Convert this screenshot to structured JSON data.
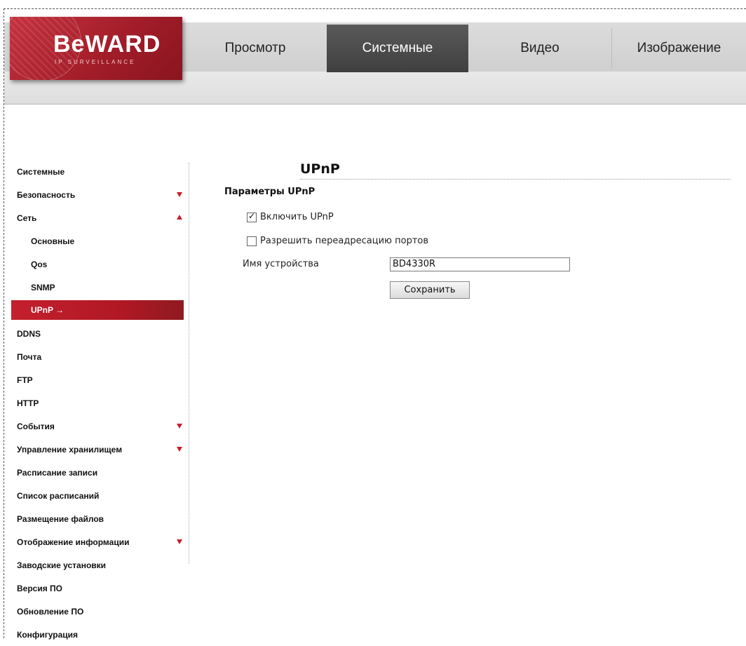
{
  "brand": {
    "name": "BeWARD",
    "tagline": "IP SURVEILLANCE",
    "color": "#b01c28"
  },
  "tabs": [
    {
      "label": "Просмотр",
      "active": false
    },
    {
      "label": "Системные",
      "active": true
    },
    {
      "label": "Видео",
      "active": false
    },
    {
      "label": "Изображение",
      "active": false
    }
  ],
  "sidebar": {
    "items": [
      {
        "label": "Системные",
        "arrow": ""
      },
      {
        "label": "Безопасность",
        "arrow": "down"
      },
      {
        "label": "Сеть",
        "arrow": "up"
      },
      {
        "label": "Основные",
        "sub": true
      },
      {
        "label": "Qos",
        "sub": true
      },
      {
        "label": "SNMP",
        "sub": true
      },
      {
        "label": "UPnP →",
        "sub": true,
        "active": true
      },
      {
        "label": "DDNS"
      },
      {
        "label": "Почта"
      },
      {
        "label": "FTP"
      },
      {
        "label": "HTTP"
      },
      {
        "label": "События",
        "arrow": "down"
      },
      {
        "label": "Управление хранилищем",
        "arrow": "down"
      },
      {
        "label": "Расписание записи"
      },
      {
        "label": "Список расписаний"
      },
      {
        "label": "Размещение файлов"
      },
      {
        "label": "Отображение информации",
        "arrow": "down"
      },
      {
        "label": "Заводские установки"
      },
      {
        "label": "Версия ПО"
      },
      {
        "label": "Обновление ПО"
      },
      {
        "label": "Конфигурация"
      }
    ]
  },
  "main": {
    "title": "UPnP",
    "section_title": "Параметры UPnP",
    "enable_upnp": {
      "label": "Включить UPnP",
      "checked": true
    },
    "port_forwarding": {
      "label": "Разрешить переадресацию портов",
      "checked": false
    },
    "device_name": {
      "label": "Имя устройства",
      "value": "BD4330R"
    },
    "save_label": "Сохранить"
  },
  "colors": {
    "accent": "#c4202d",
    "active_tab": "#4a4a4a"
  }
}
